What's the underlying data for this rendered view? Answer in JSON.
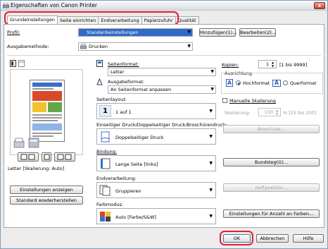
{
  "window": {
    "title": "Eigenschaften von Canon Printer",
    "close": "x"
  },
  "tabs": [
    "Grundeinstellungen",
    "Seite einrichten",
    "Endverarbeitung",
    "Papierzufuhr",
    "Qualität"
  ],
  "profile": {
    "label": "Profil:",
    "value": "Standardeinstellungen",
    "add": "Hinzufügen(1)...",
    "edit": "Bearbeiten(2)..."
  },
  "output": {
    "label": "Ausgabemethode:",
    "value": "Drucken"
  },
  "preview": {
    "caption": "Letter [Skalierung: Auto]"
  },
  "left_buttons": {
    "show_settings": "Einstellungen anzeigen",
    "restore_defaults": "Standard wiederherstellen"
  },
  "page_format": {
    "label": "Seitenformat:",
    "value": "Letter"
  },
  "output_format": {
    "label": "Ausgabeformat:",
    "value": "An Seitenformat anpassen"
  },
  "copies": {
    "label": "Kopien:",
    "value": "1",
    "range": "[1 bis 9999]"
  },
  "orientation": {
    "label": "Ausrichtung",
    "portrait": "Hochformat",
    "landscape": "Querformat",
    "icon_letter": "A"
  },
  "page_layout": {
    "label": "Seitenlayout:",
    "value": "1 auf 1",
    "icon_text": "1"
  },
  "manual_scaling": {
    "label": "Manuelle Skalierung",
    "scaling_label": "Skalierung:",
    "scaling_value": "100",
    "scaling_range": "% [25 bis 200]"
  },
  "duplex": {
    "label": "Einseitiger Druck/Doppelseitiger Druck/Broschürendruck:",
    "value": "Doppelseitiger Druck",
    "brochure": "Broschüre..."
  },
  "binding": {
    "label": "Bindung:",
    "value": "Lange Seite [links]",
    "margin_button": "Bundsteg(G)..."
  },
  "finishing": {
    "label": "Endverarbeitung:",
    "value": "Gruppieren",
    "staple_button": "Heftposition..."
  },
  "color_mode": {
    "label": "Farbmodus:",
    "value": "Auto [Farbe/S&W]",
    "color_button": "Einstellungen für Anzahl an Farben..."
  },
  "footer": {
    "ok": "OK",
    "cancel": "Abbrechen",
    "help": "Hilfe"
  },
  "colors": {
    "highlight": "#e51d2e",
    "selection": "#316ac5",
    "accent": "#1f5bb8"
  }
}
